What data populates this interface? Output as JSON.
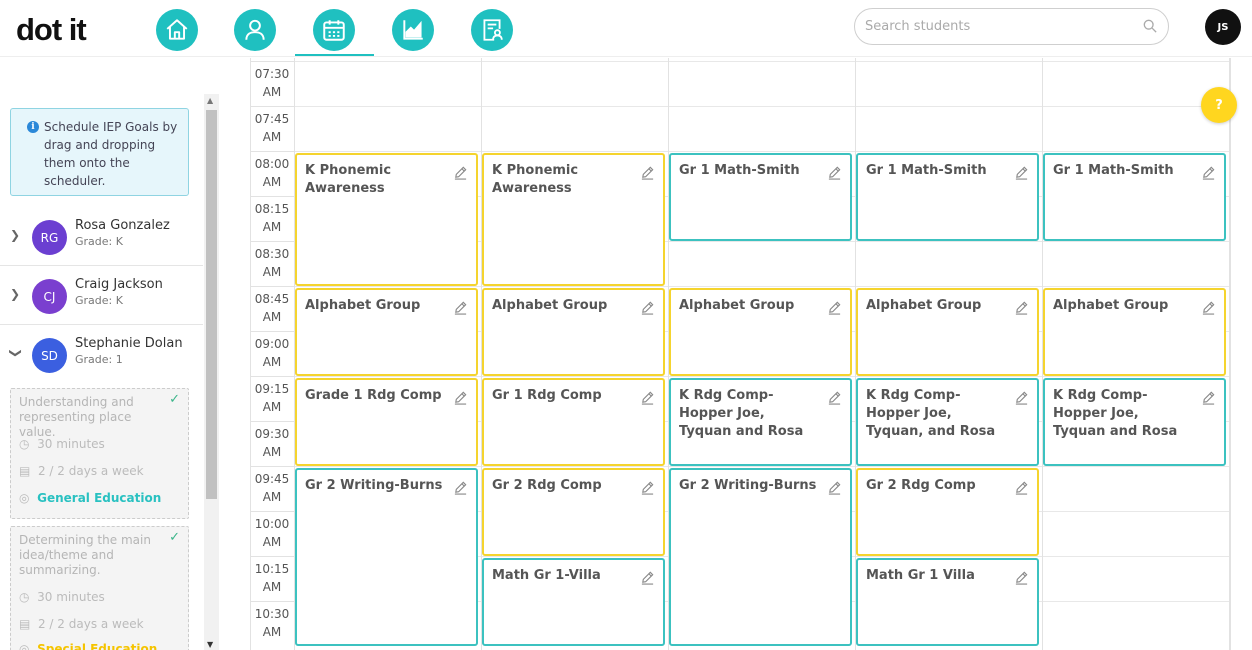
{
  "app": {
    "logo": "dot it",
    "user_initials": "JS"
  },
  "nav": {
    "items": [
      {
        "name": "home",
        "icon": "home-icon",
        "active": false
      },
      {
        "name": "students",
        "icon": "person-icon",
        "active": false
      },
      {
        "name": "schedule",
        "icon": "calendar-icon",
        "active": true
      },
      {
        "name": "reports",
        "icon": "chart-icon",
        "active": false
      },
      {
        "name": "iep",
        "icon": "document-user-icon",
        "active": false
      }
    ]
  },
  "search": {
    "placeholder": "Search students"
  },
  "sidebar": {
    "tip": "Schedule IEP Goals by drag and dropping them onto the scheduler.",
    "students": [
      {
        "initials": "RG",
        "name": "Rosa Gonzalez",
        "grade": "Grade: K",
        "color": "#6b3fd1",
        "expanded": false
      },
      {
        "initials": "CJ",
        "name": "Craig Jackson",
        "grade": "Grade: K",
        "color": "#7a3fcf",
        "expanded": false
      },
      {
        "initials": "SD",
        "name": "Stephanie Dolan",
        "grade": "Grade: 1",
        "color": "#3b5fe0",
        "expanded": true
      }
    ],
    "goals": [
      {
        "title": "Understanding and representing place value.",
        "duration": "30 minutes",
        "frequency": "2 / 2 days a week",
        "location": "General Education",
        "location_color": "#29c1c1"
      },
      {
        "title": "Determining the main idea/theme and summarizing.",
        "duration": "30 minutes",
        "frequency": "2 / 2 days a week",
        "location": "Special Education",
        "location_color": "#f5c400"
      }
    ]
  },
  "schedule": {
    "times": [
      {
        "h": "07:30",
        "p": "AM"
      },
      {
        "h": "07:45",
        "p": "AM"
      },
      {
        "h": "08:00",
        "p": "AM"
      },
      {
        "h": "08:15",
        "p": "AM"
      },
      {
        "h": "08:30",
        "p": "AM"
      },
      {
        "h": "08:45",
        "p": "AM"
      },
      {
        "h": "09:00",
        "p": "AM"
      },
      {
        "h": "09:15",
        "p": "AM"
      },
      {
        "h": "09:30",
        "p": "AM"
      },
      {
        "h": "09:45",
        "p": "AM"
      },
      {
        "h": "10:00",
        "p": "AM"
      },
      {
        "h": "10:15",
        "p": "AM"
      },
      {
        "h": "10:30",
        "p": "AM"
      }
    ],
    "events": [
      {
        "day": 0,
        "start": 2,
        "slots": 3,
        "title": "K Phonemic Awareness",
        "color": "yellow"
      },
      {
        "day": 1,
        "start": 2,
        "slots": 3,
        "title": "K Phonemic Awareness",
        "color": "yellow"
      },
      {
        "day": 2,
        "start": 2,
        "slots": 2,
        "title": "Gr 1 Math-Smith",
        "color": "teal"
      },
      {
        "day": 3,
        "start": 2,
        "slots": 2,
        "title": "Gr 1 Math-Smith",
        "color": "teal"
      },
      {
        "day": 4,
        "start": 2,
        "slots": 2,
        "title": "Gr 1 Math-Smith",
        "color": "teal"
      },
      {
        "day": 0,
        "start": 5,
        "slots": 2,
        "title": "Alphabet Group",
        "color": "yellow"
      },
      {
        "day": 1,
        "start": 5,
        "slots": 2,
        "title": "Alphabet Group",
        "color": "yellow"
      },
      {
        "day": 2,
        "start": 5,
        "slots": 2,
        "title": "Alphabet Group",
        "color": "yellow"
      },
      {
        "day": 3,
        "start": 5,
        "slots": 2,
        "title": "Alphabet Group",
        "color": "yellow"
      },
      {
        "day": 4,
        "start": 5,
        "slots": 2,
        "title": "Alphabet Group",
        "color": "yellow"
      },
      {
        "day": 0,
        "start": 7,
        "slots": 2,
        "title": "Grade 1 Rdg Comp",
        "color": "yellow"
      },
      {
        "day": 1,
        "start": 7,
        "slots": 2,
        "title": "Gr 1 Rdg Comp",
        "color": "yellow"
      },
      {
        "day": 2,
        "start": 7,
        "slots": 2,
        "title": "K Rdg Comp- Hopper Joe, Tyquan and Rosa",
        "color": "teal"
      },
      {
        "day": 3,
        "start": 7,
        "slots": 2,
        "title": "K Rdg Comp-Hopper Joe, Tyquan, and Rosa",
        "color": "teal"
      },
      {
        "day": 4,
        "start": 7,
        "slots": 2,
        "title": "K Rdg Comp-Hopper Joe, Tyquan and Rosa",
        "color": "teal"
      },
      {
        "day": 0,
        "start": 9,
        "slots": 4,
        "title": "Gr 2 Writing-Burns",
        "color": "teal"
      },
      {
        "day": 1,
        "start": 9,
        "slots": 2,
        "title": "Gr 2 Rdg Comp",
        "color": "yellow"
      },
      {
        "day": 2,
        "start": 9,
        "slots": 4,
        "title": "Gr 2 Writing-Burns",
        "color": "teal"
      },
      {
        "day": 3,
        "start": 9,
        "slots": 2,
        "title": "Gr 2 Rdg Comp",
        "color": "yellow"
      },
      {
        "day": 1,
        "start": 11,
        "slots": 2,
        "title": "Math Gr 1-Villa",
        "color": "teal"
      },
      {
        "day": 3,
        "start": 11,
        "slots": 2,
        "title": "Math Gr 1 Villa",
        "color": "teal"
      }
    ]
  },
  "help": {
    "label": "?"
  }
}
